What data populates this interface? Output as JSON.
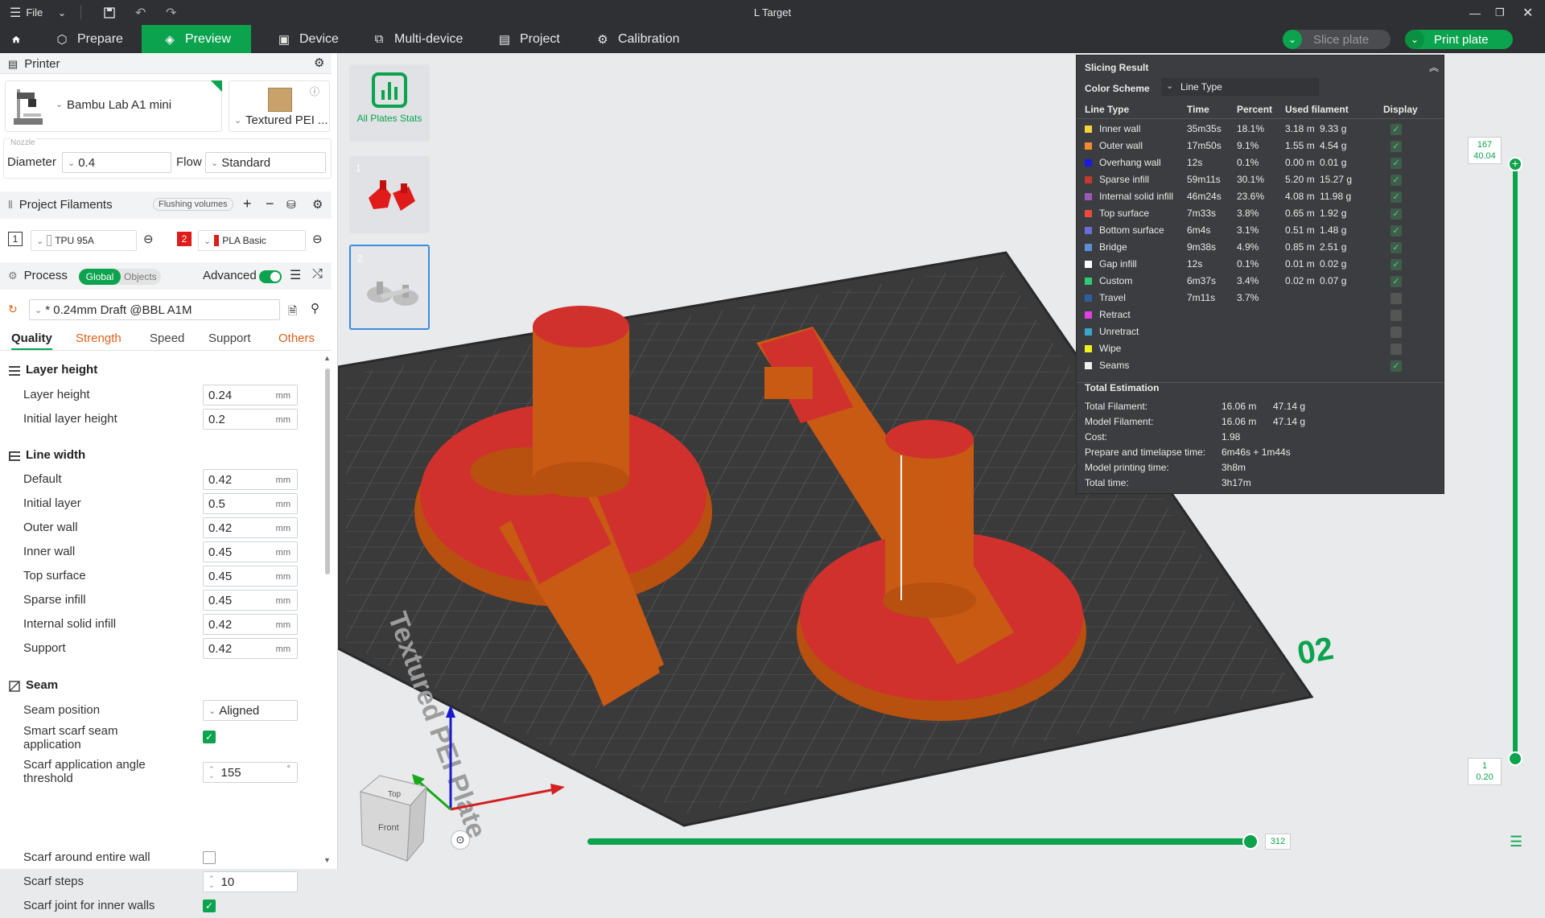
{
  "window": {
    "title": "L Target",
    "file_label": "File"
  },
  "nav": {
    "tabs": [
      {
        "label": "Prepare"
      },
      {
        "label": "Preview"
      },
      {
        "label": "Device"
      },
      {
        "label": "Multi-device"
      },
      {
        "label": "Project"
      },
      {
        "label": "Calibration"
      }
    ],
    "slice_plate": "Slice plate",
    "print_plate": "Print plate"
  },
  "printer": {
    "section": "Printer",
    "name": "Bambu Lab A1 mini",
    "plate": "Textured PEI ...",
    "nozzle_label": "Nozzle",
    "diameter_label": "Diameter",
    "diameter": "0.4",
    "flow_label": "Flow",
    "flow": "Standard"
  },
  "filaments": {
    "section": "Project Filaments",
    "flushing": "Flushing volumes",
    "items": [
      {
        "num": "1",
        "name": "TPU 95A",
        "color": "#ffffff"
      },
      {
        "num": "2",
        "name": "PLA Basic",
        "color": "#e01b1b"
      }
    ]
  },
  "process": {
    "section": "Process",
    "global": "Global",
    "objects": "Objects",
    "advanced": "Advanced",
    "preset": "* 0.24mm Draft @BBL A1M",
    "tabs": [
      "Quality",
      "Strength",
      "Speed",
      "Support",
      "Others"
    ]
  },
  "quality": {
    "layer_height_group": "Layer height",
    "layer_rows": [
      {
        "label": "Layer height",
        "value": "0.24",
        "unit": "mm"
      },
      {
        "label": "Initial layer height",
        "value": "0.2",
        "unit": "mm"
      }
    ],
    "line_width_group": "Line width",
    "line_rows": [
      {
        "label": "Default",
        "value": "0.42",
        "unit": "mm"
      },
      {
        "label": "Initial layer",
        "value": "0.5",
        "unit": "mm"
      },
      {
        "label": "Outer wall",
        "value": "0.42",
        "unit": "mm"
      },
      {
        "label": "Inner wall",
        "value": "0.45",
        "unit": "mm"
      },
      {
        "label": "Top surface",
        "value": "0.45",
        "unit": "mm"
      },
      {
        "label": "Sparse infill",
        "value": "0.45",
        "unit": "mm"
      },
      {
        "label": "Internal solid infill",
        "value": "0.42",
        "unit": "mm"
      },
      {
        "label": "Support",
        "value": "0.42",
        "unit": "mm"
      }
    ],
    "seam_group": "Seam",
    "seam_position_label": "Seam position",
    "seam_position": "Aligned",
    "smart_scarf_label": "Smart scarf seam application",
    "smart_scarf": true,
    "scarf_angle_label": "Scarf application angle threshold",
    "scarf_angle": "155",
    "scarf_angle_unit": "°",
    "scarf_entire_label": "Scarf around entire wall",
    "scarf_entire": false,
    "scarf_steps_label": "Scarf steps",
    "scarf_steps": "10",
    "scarf_inner_label": "Scarf joint for inner walls",
    "scarf_inner": true
  },
  "plates": {
    "all_stats": "All Plates Stats",
    "items": [
      {
        "num": "1"
      },
      {
        "num": "2"
      }
    ]
  },
  "slicing": {
    "title": "Slicing Result",
    "color_scheme_label": "Color Scheme",
    "color_scheme": "Line Type",
    "headers": [
      "Line Type",
      "Time",
      "Percent",
      "Used filament",
      "Display"
    ],
    "rows": [
      {
        "name": "Inner wall",
        "color": "#f5d33b",
        "time": "35m35s",
        "pct": "18.1%",
        "len": "3.18 m",
        "wt": "9.33 g",
        "display": true
      },
      {
        "name": "Outer wall",
        "color": "#f28b30",
        "time": "17m50s",
        "pct": "9.1%",
        "len": "1.55 m",
        "wt": "4.54 g",
        "display": true
      },
      {
        "name": "Overhang wall",
        "color": "#1a1ae0",
        "time": "12s",
        "pct": "0.1%",
        "len": "0.00 m",
        "wt": "0.01 g",
        "display": true
      },
      {
        "name": "Sparse infill",
        "color": "#c0392b",
        "time": "59m11s",
        "pct": "30.1%",
        "len": "5.20 m",
        "wt": "15.27 g",
        "display": true
      },
      {
        "name": "Internal solid infill",
        "color": "#9b59b6",
        "time": "46m24s",
        "pct": "23.6%",
        "len": "4.08 m",
        "wt": "11.98 g",
        "display": true
      },
      {
        "name": "Top surface",
        "color": "#e74c3c",
        "time": "7m33s",
        "pct": "3.8%",
        "len": "0.65 m",
        "wt": "1.92 g",
        "display": true
      },
      {
        "name": "Bottom surface",
        "color": "#6c6cd8",
        "time": "6m4s",
        "pct": "3.1%",
        "len": "0.51 m",
        "wt": "1.48 g",
        "display": true
      },
      {
        "name": "Bridge",
        "color": "#5b8fd6",
        "time": "9m38s",
        "pct": "4.9%",
        "len": "0.85 m",
        "wt": "2.51 g",
        "display": true
      },
      {
        "name": "Gap infill",
        "color": "#ffffff",
        "time": "12s",
        "pct": "0.1%",
        "len": "0.01 m",
        "wt": "0.02 g",
        "display": true
      },
      {
        "name": "Custom",
        "color": "#2ecc71",
        "time": "6m37s",
        "pct": "3.4%",
        "len": "0.02 m",
        "wt": "0.07 g",
        "display": true
      },
      {
        "name": "Travel",
        "color": "#2c5f9e",
        "time": "7m11s",
        "pct": "3.7%",
        "len": "",
        "wt": "",
        "display": false
      },
      {
        "name": "Retract",
        "color": "#e040e0",
        "time": "",
        "pct": "",
        "len": "",
        "wt": "",
        "display": false
      },
      {
        "name": "Unretract",
        "color": "#3aa6c9",
        "time": "",
        "pct": "",
        "len": "",
        "wt": "",
        "display": false
      },
      {
        "name": "Wipe",
        "color": "#f0f020",
        "time": "",
        "pct": "",
        "len": "",
        "wt": "",
        "display": false
      },
      {
        "name": "Seams",
        "color": "#f0f0f0",
        "time": "",
        "pct": "",
        "len": "",
        "wt": "",
        "display": true
      }
    ],
    "total_title": "Total Estimation",
    "totals": [
      {
        "label": "Total Filament:",
        "v1": "16.06 m",
        "v2": "47.14 g"
      },
      {
        "label": "Model Filament:",
        "v1": "16.06 m",
        "v2": "47.14 g"
      },
      {
        "label": "Cost:",
        "v1": "1.98",
        "v2": ""
      },
      {
        "label": "Prepare and timelapse time:",
        "v1": "6m46s + 1m44s",
        "v2": ""
      },
      {
        "label": "Model printing time:",
        "v1": "3h8m",
        "v2": ""
      },
      {
        "label": "Total time:",
        "v1": "3h17m",
        "v2": ""
      }
    ]
  },
  "layer_slider": {
    "top_layer": "167",
    "top_height": "40.04",
    "bottom_layer": "1",
    "bottom_height": "0.20"
  },
  "move_slider": {
    "value": "312"
  },
  "bed": {
    "label": "Textured PEI Plate",
    "plate_number": "02"
  },
  "viewcube": {
    "top": "Top",
    "front": "Front"
  },
  "colors": {
    "accent": "#0ba34d",
    "model": "#c85a14",
    "infill": "#d0312d"
  }
}
